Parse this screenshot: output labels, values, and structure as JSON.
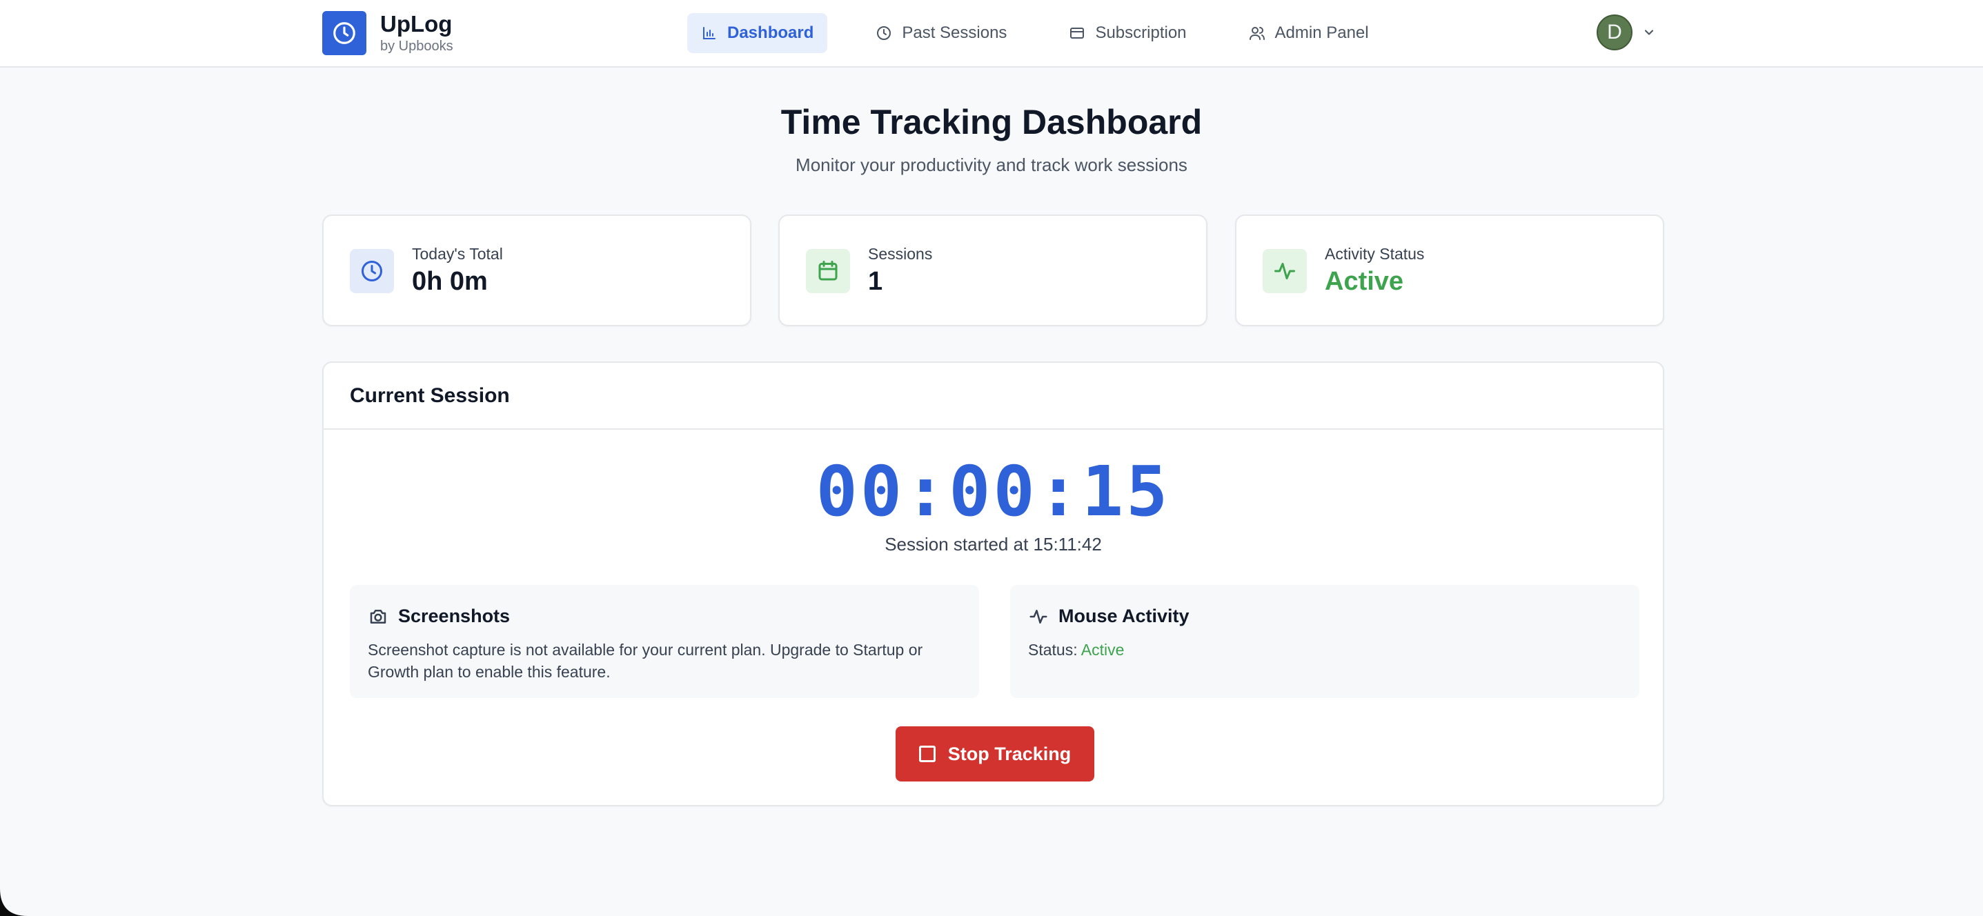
{
  "brand": {
    "name": "UpLog",
    "sub": "by Upbooks"
  },
  "nav": [
    {
      "label": "Dashboard",
      "icon": "bar-chart-icon",
      "active": true
    },
    {
      "label": "Past Sessions",
      "icon": "clock-icon",
      "active": false
    },
    {
      "label": "Subscription",
      "icon": "credit-card-icon",
      "active": false
    },
    {
      "label": "Admin Panel",
      "icon": "users-icon",
      "active": false
    }
  ],
  "user": {
    "initial": "D"
  },
  "hero": {
    "title": "Time Tracking Dashboard",
    "subtitle": "Monitor your productivity and track work sessions"
  },
  "stats": [
    {
      "label": "Today's Total",
      "value": "0h 0m",
      "icon": "clock-icon"
    },
    {
      "label": "Sessions",
      "value": "1",
      "icon": "calendar-icon"
    },
    {
      "label": "Activity Status",
      "value": "Active",
      "icon": "activity-icon"
    }
  ],
  "session": {
    "title": "Current Session",
    "timer": "00:00:15",
    "started": "Session started at 15:11:42",
    "screenshots": {
      "title": "Screenshots",
      "text": "Screenshot capture is not available for your current plan. Upgrade to Startup or Growth plan to enable this feature."
    },
    "mouse": {
      "title": "Mouse Activity",
      "status_label": "Status:",
      "status_value": "Active"
    },
    "stop_label": "Stop Tracking"
  },
  "colors": {
    "primary": "#2f62d9",
    "success": "#3da34d",
    "danger": "#d2332f"
  }
}
